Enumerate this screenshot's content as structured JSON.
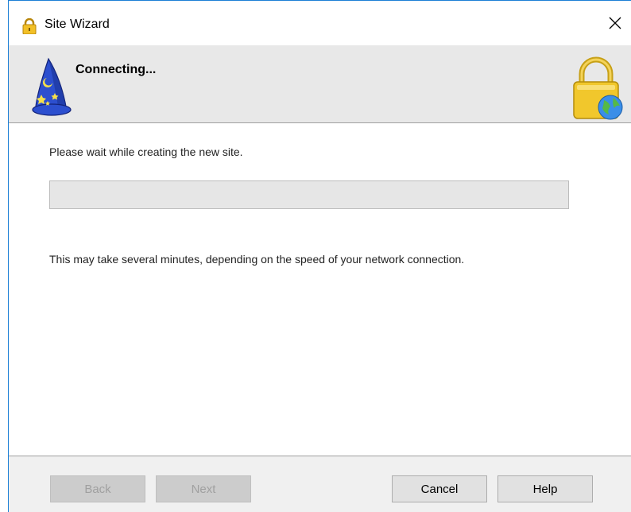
{
  "window": {
    "title": "Site Wizard",
    "icon": "lock-icon",
    "close_icon": "close-icon"
  },
  "header": {
    "title": "Connecting...",
    "left_icon": "wizard-hat-icon",
    "right_icon": "lock-globe-icon"
  },
  "content": {
    "wait_text": "Please wait while creating the new site.",
    "progress": 0,
    "note_text": "This may take several minutes, depending on the speed of your network connection."
  },
  "footer": {
    "back_label": "Back",
    "next_label": "Next",
    "cancel_label": "Cancel",
    "help_label": "Help"
  },
  "colors": {
    "accent_border": "#1c7fd6",
    "header_bg": "#e8e8e8",
    "footer_bg": "#f0f0f0",
    "progress_bg": "#e6e6e6",
    "progress_fill": "#06b025"
  }
}
